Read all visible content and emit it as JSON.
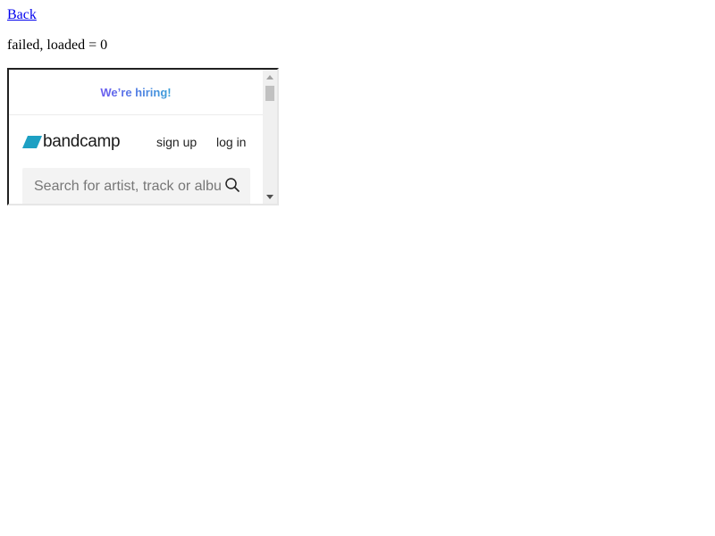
{
  "page": {
    "back_link": "Back",
    "status": "failed, loaded = 0"
  },
  "embed": {
    "hiring_banner": "We’re hiring!",
    "logo_text": "bandcamp",
    "logo_color": "#1da0c3",
    "nav": {
      "signup": "sign up",
      "login": "log in"
    },
    "search": {
      "placeholder": "Search for artist, track or album",
      "value": ""
    }
  }
}
